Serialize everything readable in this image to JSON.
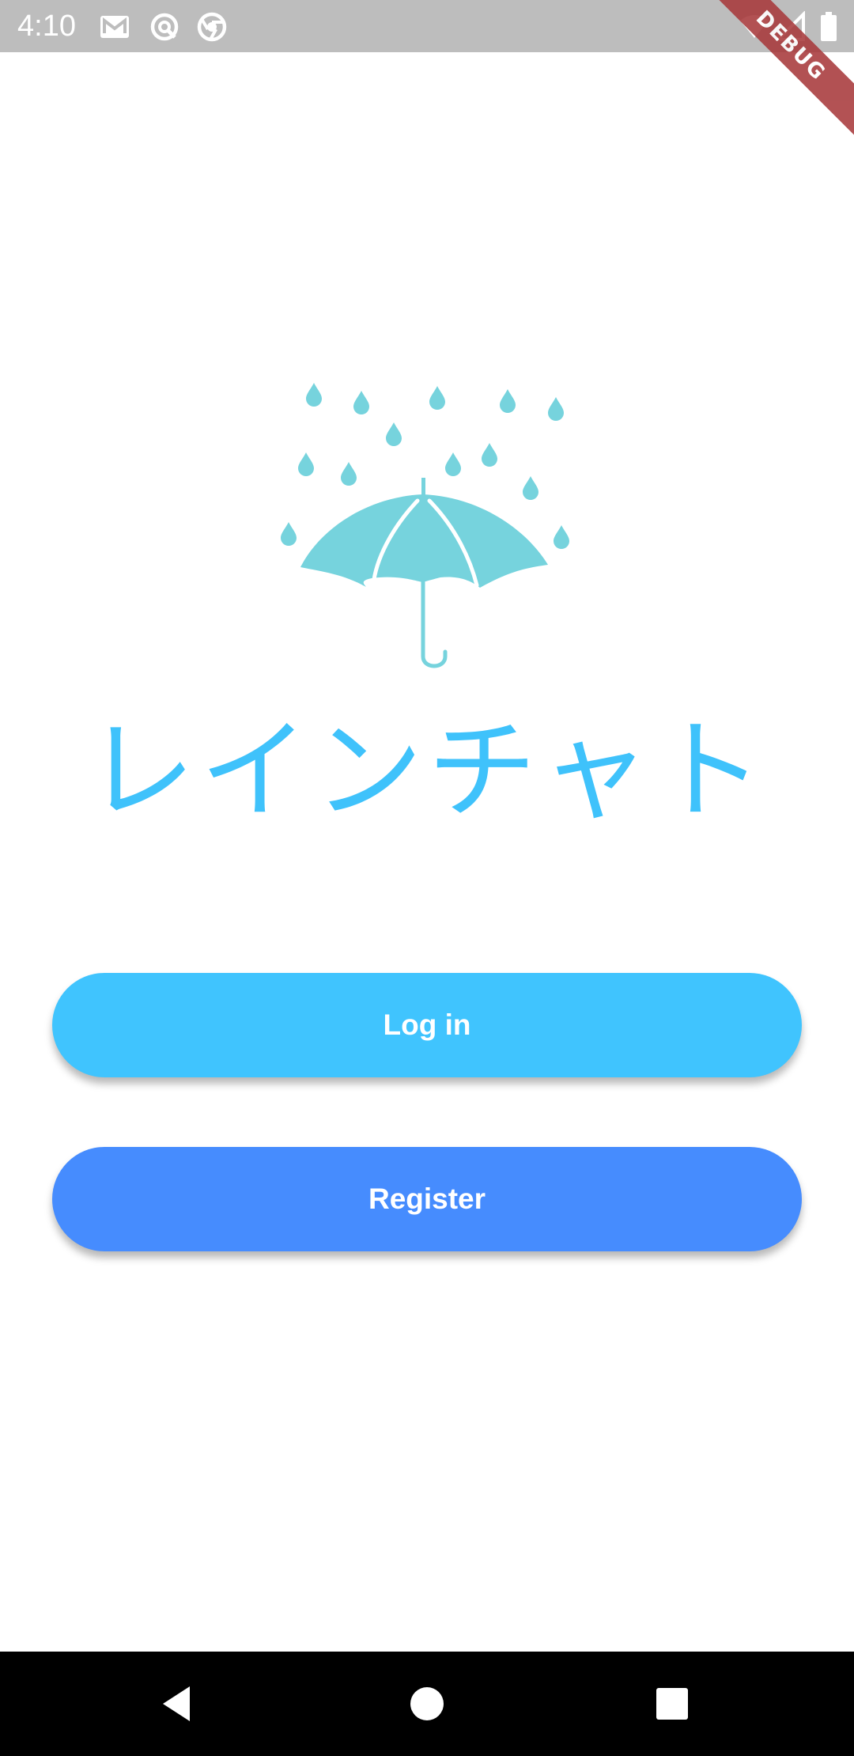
{
  "status_bar": {
    "time": "4:10",
    "icons": [
      "gmail-icon",
      "sync-icon",
      "chrome-icon",
      "wifi-icon",
      "signal-icon",
      "battery-icon"
    ],
    "debug_label": "DEBUG",
    "background_color": "#bdbdbd"
  },
  "app": {
    "title": "レインチャト",
    "logo_icon": "umbrella-rain-icon",
    "title_color": "#3fc2fb",
    "logo_color": "#76d3dd"
  },
  "buttons": {
    "login_label": "Log in",
    "login_color": "#40c4fe",
    "register_label": "Register",
    "register_color": "#468cfe"
  },
  "nav_bar": {
    "icons": [
      "back-icon",
      "home-icon",
      "recents-icon"
    ]
  }
}
